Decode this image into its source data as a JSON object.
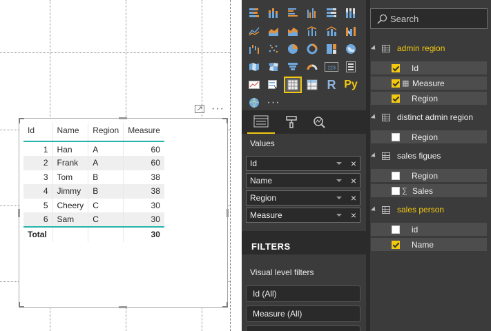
{
  "table_visual": {
    "headers": [
      "Id",
      "Name",
      "Region",
      "Measure"
    ],
    "rows": [
      [
        "1",
        "Han",
        "A",
        "60"
      ],
      [
        "2",
        "Frank",
        "A",
        "60"
      ],
      [
        "3",
        "Tom",
        "B",
        "38"
      ],
      [
        "4",
        "Jimmy",
        "B",
        "38"
      ],
      [
        "5",
        "Cheery",
        "C",
        "30"
      ],
      [
        "6",
        "Sam",
        "C",
        "30"
      ]
    ],
    "total_label": "Total",
    "total_value": "30"
  },
  "visualizations": {
    "icons": [
      "stacked-bar-chart",
      "stacked-column-chart",
      "clustered-bar-chart",
      "clustered-column-chart",
      "100-stacked-bar-chart",
      "100-stacked-column-chart",
      "line-chart",
      "area-chart",
      "stacked-area-chart",
      "line-clustered-column-chart",
      "line-stacked-column-chart",
      "ribbon-chart",
      "waterfall-chart",
      "scatter-chart",
      "pie-chart",
      "donut-chart",
      "treemap",
      "map",
      "filled-map",
      "shape-map",
      "funnel",
      "gauge",
      "card",
      "multi-row-card",
      "kpi",
      "slicer",
      "table",
      "matrix",
      "r-visual",
      "python-visual",
      "arcgis-map",
      "more-visuals"
    ],
    "selected_icon": "table",
    "r_glyph": "R",
    "py_glyph": "Py",
    "more_glyph": "···",
    "card_glyph": "123",
    "values_title": "Values",
    "value_wells": [
      "Id",
      "Name",
      "Region",
      "Measure"
    ],
    "remove_glyph": "×",
    "filters_title": "FILTERS",
    "visual_level_filters_label": "Visual level filters",
    "filter_cards": [
      "Id  (All)",
      "Measure  (All)"
    ]
  },
  "fields": {
    "search_placeholder": "Search",
    "tables": [
      {
        "name": "admin region",
        "active": true,
        "fields": [
          {
            "name": "Id",
            "checked": true,
            "symbol": ""
          },
          {
            "name": "Measure",
            "checked": true,
            "symbol": "▦"
          },
          {
            "name": "Region",
            "checked": true,
            "symbol": ""
          }
        ]
      },
      {
        "name": "distinct admin region",
        "active": false,
        "fields": [
          {
            "name": "Region",
            "checked": false,
            "symbol": ""
          }
        ]
      },
      {
        "name": "sales figues",
        "active": false,
        "fields": [
          {
            "name": "Region",
            "checked": false,
            "symbol": ""
          },
          {
            "name": "Sales",
            "checked": false,
            "symbol": "∑"
          }
        ]
      },
      {
        "name": "sales person",
        "active": true,
        "fields": [
          {
            "name": "id",
            "checked": false,
            "symbol": ""
          },
          {
            "name": "Name",
            "checked": true,
            "symbol": ""
          }
        ]
      }
    ]
  },
  "colors": {
    "accent_yellow": "#f2c811",
    "table_rule_teal": "#28b4a9",
    "pane_dark": "#3b3b3b"
  }
}
